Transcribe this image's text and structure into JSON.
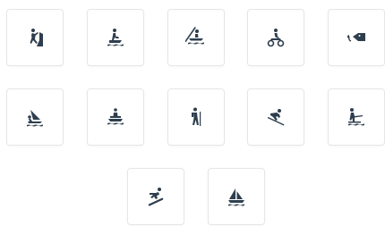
{
  "icon_color": "#2e3e4e",
  "tiles": [
    {
      "icon": "rock-climbing-icon"
    },
    {
      "icon": "jet-ski-icon"
    },
    {
      "icon": "kayaking-icon"
    },
    {
      "icon": "atv-icon"
    },
    {
      "icon": "fishing-icon"
    },
    {
      "icon": "windsurfing-icon"
    },
    {
      "icon": "boat-tour-icon"
    },
    {
      "icon": "hiking-icon"
    },
    {
      "icon": "skiing-icon"
    },
    {
      "icon": "water-skiing-icon"
    },
    {
      "icon": "snowboarding-icon"
    },
    {
      "icon": "sailing-icon"
    }
  ]
}
